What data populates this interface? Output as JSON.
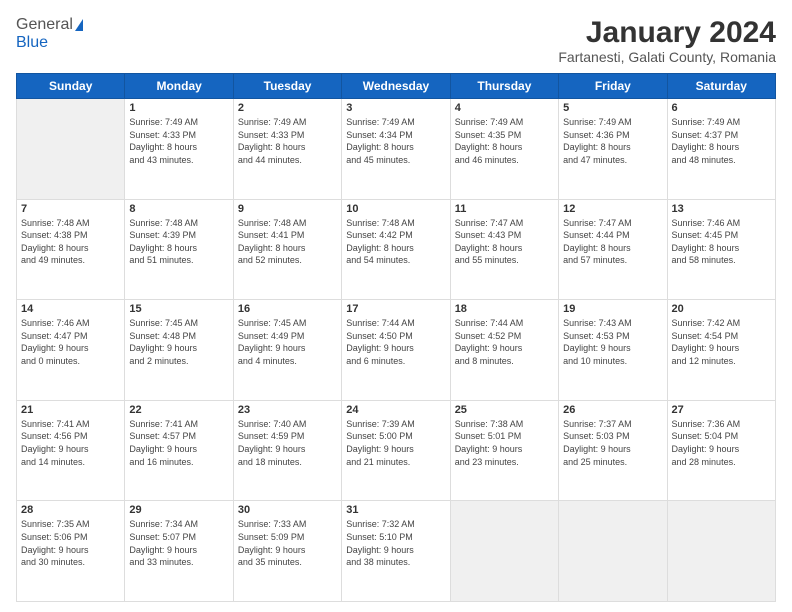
{
  "header": {
    "logo": {
      "line1": "General",
      "line2": "Blue"
    },
    "title": "January 2024",
    "location": "Fartanesti, Galati County, Romania"
  },
  "weekdays": [
    "Sunday",
    "Monday",
    "Tuesday",
    "Wednesday",
    "Thursday",
    "Friday",
    "Saturday"
  ],
  "weeks": [
    [
      {
        "day": "",
        "info": ""
      },
      {
        "day": "1",
        "info": "Sunrise: 7:49 AM\nSunset: 4:33 PM\nDaylight: 8 hours\nand 43 minutes."
      },
      {
        "day": "2",
        "info": "Sunrise: 7:49 AM\nSunset: 4:33 PM\nDaylight: 8 hours\nand 44 minutes."
      },
      {
        "day": "3",
        "info": "Sunrise: 7:49 AM\nSunset: 4:34 PM\nDaylight: 8 hours\nand 45 minutes."
      },
      {
        "day": "4",
        "info": "Sunrise: 7:49 AM\nSunset: 4:35 PM\nDaylight: 8 hours\nand 46 minutes."
      },
      {
        "day": "5",
        "info": "Sunrise: 7:49 AM\nSunset: 4:36 PM\nDaylight: 8 hours\nand 47 minutes."
      },
      {
        "day": "6",
        "info": "Sunrise: 7:49 AM\nSunset: 4:37 PM\nDaylight: 8 hours\nand 48 minutes."
      }
    ],
    [
      {
        "day": "7",
        "info": "Sunrise: 7:48 AM\nSunset: 4:38 PM\nDaylight: 8 hours\nand 49 minutes."
      },
      {
        "day": "8",
        "info": "Sunrise: 7:48 AM\nSunset: 4:39 PM\nDaylight: 8 hours\nand 51 minutes."
      },
      {
        "day": "9",
        "info": "Sunrise: 7:48 AM\nSunset: 4:41 PM\nDaylight: 8 hours\nand 52 minutes."
      },
      {
        "day": "10",
        "info": "Sunrise: 7:48 AM\nSunset: 4:42 PM\nDaylight: 8 hours\nand 54 minutes."
      },
      {
        "day": "11",
        "info": "Sunrise: 7:47 AM\nSunset: 4:43 PM\nDaylight: 8 hours\nand 55 minutes."
      },
      {
        "day": "12",
        "info": "Sunrise: 7:47 AM\nSunset: 4:44 PM\nDaylight: 8 hours\nand 57 minutes."
      },
      {
        "day": "13",
        "info": "Sunrise: 7:46 AM\nSunset: 4:45 PM\nDaylight: 8 hours\nand 58 minutes."
      }
    ],
    [
      {
        "day": "14",
        "info": "Sunrise: 7:46 AM\nSunset: 4:47 PM\nDaylight: 9 hours\nand 0 minutes."
      },
      {
        "day": "15",
        "info": "Sunrise: 7:45 AM\nSunset: 4:48 PM\nDaylight: 9 hours\nand 2 minutes."
      },
      {
        "day": "16",
        "info": "Sunrise: 7:45 AM\nSunset: 4:49 PM\nDaylight: 9 hours\nand 4 minutes."
      },
      {
        "day": "17",
        "info": "Sunrise: 7:44 AM\nSunset: 4:50 PM\nDaylight: 9 hours\nand 6 minutes."
      },
      {
        "day": "18",
        "info": "Sunrise: 7:44 AM\nSunset: 4:52 PM\nDaylight: 9 hours\nand 8 minutes."
      },
      {
        "day": "19",
        "info": "Sunrise: 7:43 AM\nSunset: 4:53 PM\nDaylight: 9 hours\nand 10 minutes."
      },
      {
        "day": "20",
        "info": "Sunrise: 7:42 AM\nSunset: 4:54 PM\nDaylight: 9 hours\nand 12 minutes."
      }
    ],
    [
      {
        "day": "21",
        "info": "Sunrise: 7:41 AM\nSunset: 4:56 PM\nDaylight: 9 hours\nand 14 minutes."
      },
      {
        "day": "22",
        "info": "Sunrise: 7:41 AM\nSunset: 4:57 PM\nDaylight: 9 hours\nand 16 minutes."
      },
      {
        "day": "23",
        "info": "Sunrise: 7:40 AM\nSunset: 4:59 PM\nDaylight: 9 hours\nand 18 minutes."
      },
      {
        "day": "24",
        "info": "Sunrise: 7:39 AM\nSunset: 5:00 PM\nDaylight: 9 hours\nand 21 minutes."
      },
      {
        "day": "25",
        "info": "Sunrise: 7:38 AM\nSunset: 5:01 PM\nDaylight: 9 hours\nand 23 minutes."
      },
      {
        "day": "26",
        "info": "Sunrise: 7:37 AM\nSunset: 5:03 PM\nDaylight: 9 hours\nand 25 minutes."
      },
      {
        "day": "27",
        "info": "Sunrise: 7:36 AM\nSunset: 5:04 PM\nDaylight: 9 hours\nand 28 minutes."
      }
    ],
    [
      {
        "day": "28",
        "info": "Sunrise: 7:35 AM\nSunset: 5:06 PM\nDaylight: 9 hours\nand 30 minutes."
      },
      {
        "day": "29",
        "info": "Sunrise: 7:34 AM\nSunset: 5:07 PM\nDaylight: 9 hours\nand 33 minutes."
      },
      {
        "day": "30",
        "info": "Sunrise: 7:33 AM\nSunset: 5:09 PM\nDaylight: 9 hours\nand 35 minutes."
      },
      {
        "day": "31",
        "info": "Sunrise: 7:32 AM\nSunset: 5:10 PM\nDaylight: 9 hours\nand 38 minutes."
      },
      {
        "day": "",
        "info": ""
      },
      {
        "day": "",
        "info": ""
      },
      {
        "day": "",
        "info": ""
      }
    ]
  ]
}
